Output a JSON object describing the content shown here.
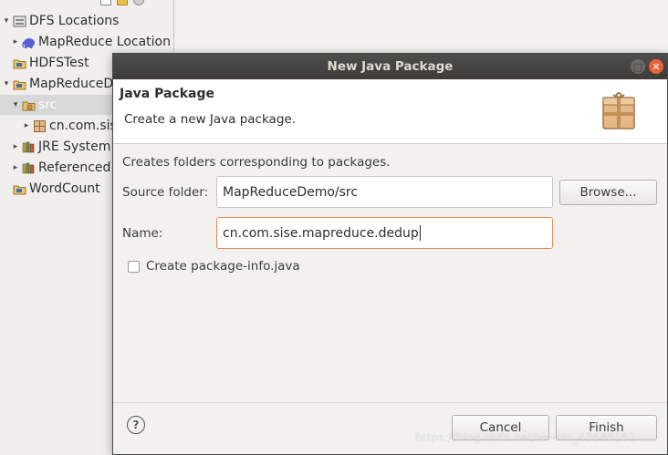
{
  "explorer": {
    "items": [
      {
        "label": "DFS Locations",
        "icon": "dfs-locations-icon",
        "twisty": "▾",
        "indent": 0
      },
      {
        "label": "MapReduce Location",
        "icon": "hadoop-elephant-icon",
        "twisty": "▸",
        "indent": 1
      },
      {
        "label": "HDFSTest",
        "icon": "java-project-icon",
        "twisty": "",
        "indent": 0
      },
      {
        "label": "MapReduceDemo",
        "icon": "java-project-icon",
        "twisty": "▾",
        "indent": 0
      },
      {
        "label": "src",
        "icon": "source-folder-icon",
        "twisty": "▾",
        "indent": 1
      },
      {
        "label": "cn.com.sise",
        "icon": "package-icon",
        "twisty": "▸",
        "indent": 2
      },
      {
        "label": "JRE System Library",
        "icon": "library-icon",
        "twisty": "▸",
        "indent": 1
      },
      {
        "label": "Referenced Libraries",
        "icon": "library-icon",
        "twisty": "▸",
        "indent": 1
      },
      {
        "label": "WordCount",
        "icon": "java-project-icon",
        "twisty": "",
        "indent": 0
      }
    ]
  },
  "dialog": {
    "title": "New Java Package",
    "banner_title": "Java Package",
    "banner_desc": "Create a new Java package.",
    "body_desc": "Creates folders corresponding to packages.",
    "source_folder_label": "Source folder:",
    "source_folder_value": "MapReduceDemo/src",
    "browse_label": "Browse...",
    "name_label": "Name:",
    "name_value": "cn.com.sise.mapreduce.dedup",
    "checkbox_label": "Create package-info.java",
    "checkbox_checked": false,
    "cancel_label": "Cancel",
    "finish_label": "Finish",
    "help_glyph": "?",
    "close_glyph": "✕",
    "maximize_glyph": "□"
  },
  "watermark": "https://blog.csdn.net/weixin_43640161"
}
